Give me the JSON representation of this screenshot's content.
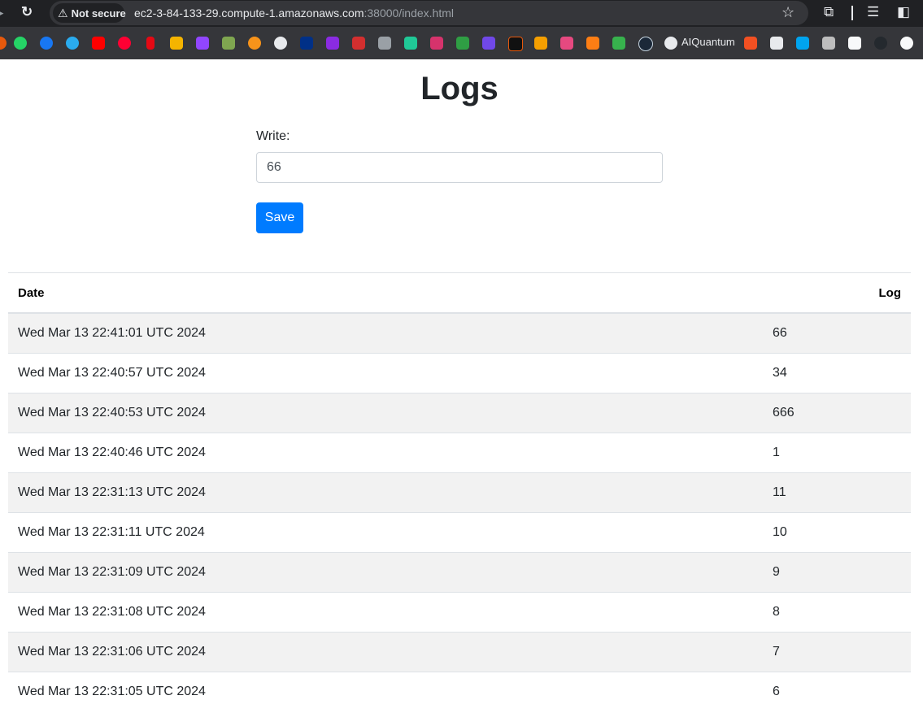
{
  "browser": {
    "security_label": "Not secure",
    "url_host": "ec2-3-84-133-29.compute-1.amazonaws.com",
    "url_path": ":38000/index.html",
    "bookmark_label": "AIQuantum"
  },
  "page": {
    "title": "Logs",
    "write_label": "Write:",
    "input_value": "66",
    "save_label": "Save"
  },
  "table": {
    "headers": {
      "date": "Date",
      "log": "Log"
    },
    "rows": [
      {
        "date": "Wed Mar 13 22:41:01 UTC 2024",
        "log": "66"
      },
      {
        "date": "Wed Mar 13 22:40:57 UTC 2024",
        "log": "34"
      },
      {
        "date": "Wed Mar 13 22:40:53 UTC 2024",
        "log": "666"
      },
      {
        "date": "Wed Mar 13 22:40:46 UTC 2024",
        "log": "1"
      },
      {
        "date": "Wed Mar 13 22:31:13 UTC 2024",
        "log": "11"
      },
      {
        "date": "Wed Mar 13 22:31:11 UTC 2024",
        "log": "10"
      },
      {
        "date": "Wed Mar 13 22:31:09 UTC 2024",
        "log": "9"
      },
      {
        "date": "Wed Mar 13 22:31:08 UTC 2024",
        "log": "8"
      },
      {
        "date": "Wed Mar 13 22:31:06 UTC 2024",
        "log": "7"
      },
      {
        "date": "Wed Mar 13 22:31:05 UTC 2024",
        "log": "6"
      }
    ]
  },
  "colors": {
    "primary": "#007bff",
    "stripe": "#f2f2f2",
    "chrome_dark": "#202124",
    "chrome_bar": "#35363a"
  }
}
